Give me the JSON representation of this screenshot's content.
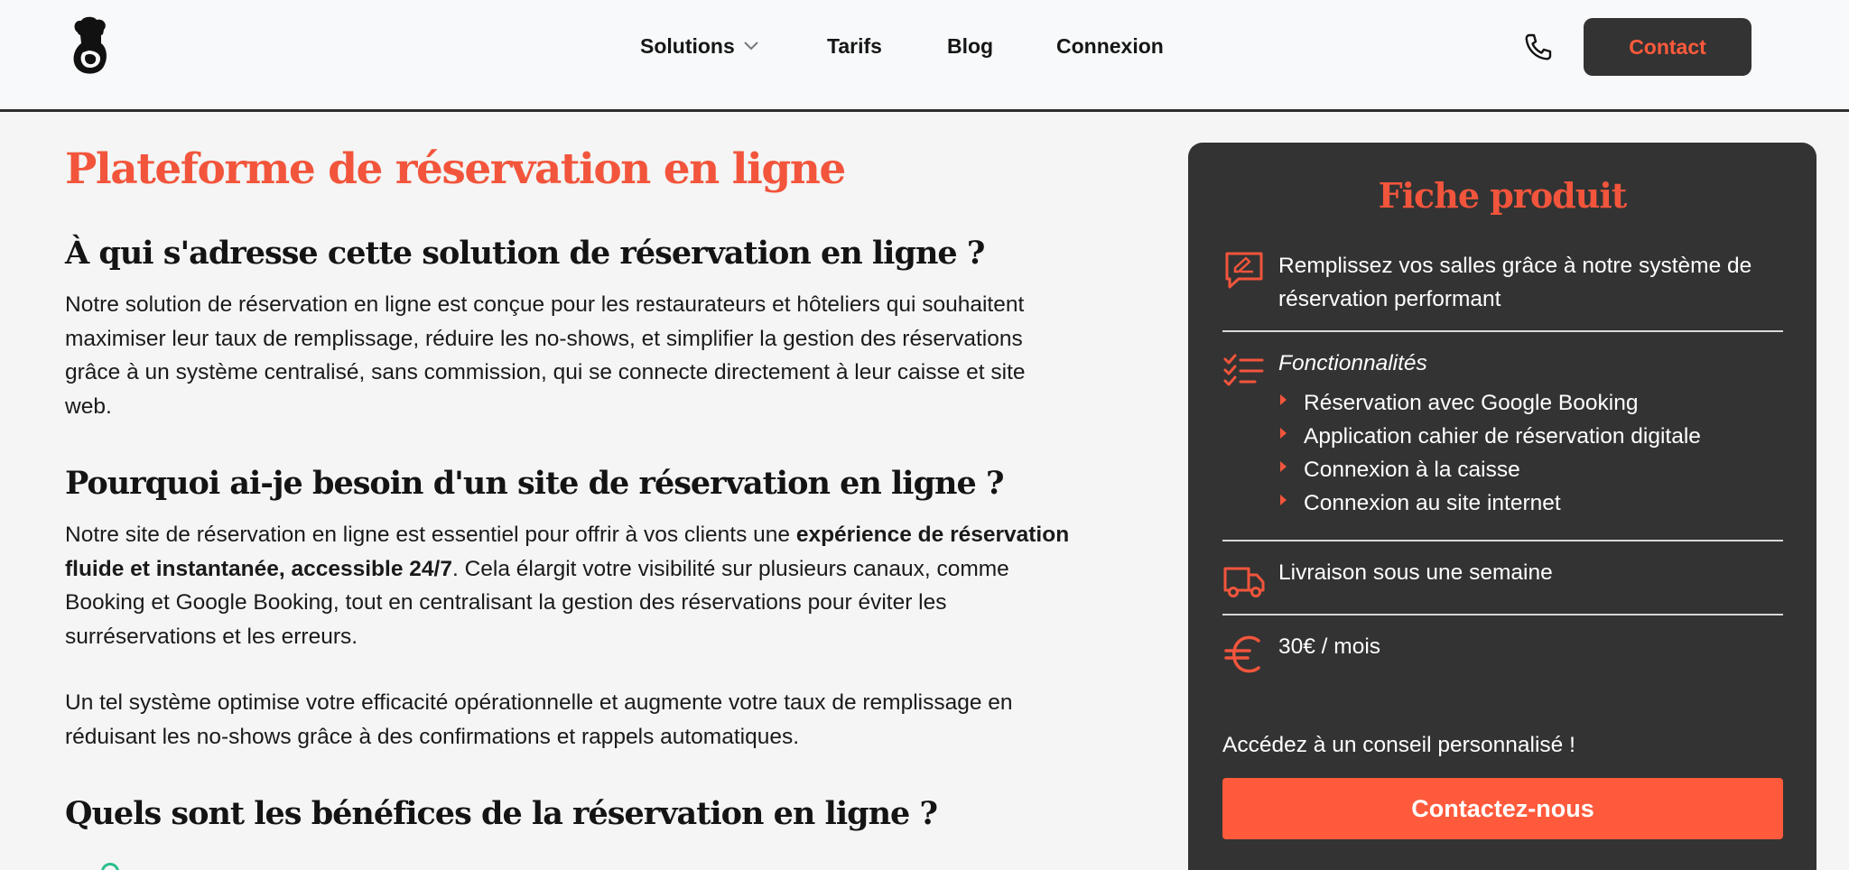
{
  "header": {
    "nav": {
      "solutions": "Solutions",
      "tarifs": "Tarifs",
      "blog": "Blog",
      "connexion": "Connexion"
    },
    "contact_label": "Contact"
  },
  "main": {
    "title": "Plateforme de réservation en ligne",
    "sections": [
      {
        "heading": "À qui s'adresse cette solution de réservation en ligne ?",
        "text": "Notre solution de réservation en ligne est conçue pour les restaurateurs et hôteliers qui souhaitent maximiser leur taux de remplissage, réduire les no-shows, et simplifier la gestion des réservations grâce à un système centralisé, sans commission, qui se connecte directement à leur caisse et site web."
      },
      {
        "heading": "Pourquoi ai-je besoin d'un site de réservation en ligne ?",
        "text_before": "Notre site de réservation en ligne est essentiel pour offrir à vos clients une ",
        "text_bold": "expérience de réservation fluide et instantanée, accessible 24/7",
        "text_after": ". Cela élargit votre visibilité sur plusieurs canaux, comme Booking et Google Booking, tout en centralisant la gestion des réservations pour éviter les surréservations et les erreurs.",
        "text2": "Un tel système optimise votre efficacité opérationnelle et augmente votre taux de remplissage en réduisant les no-shows grâce à des confirmations et rappels automatiques."
      },
      {
        "heading": "Quels sont les bénéfices de la réservation en ligne ?"
      }
    ]
  },
  "card": {
    "title": "Fiche produit",
    "intro": "Remplissez vos salles grâce à notre système de réservation performant",
    "features_title": "Fonctionnalités",
    "features": [
      "Réservation avec Google Booking",
      "Application cahier de réservation digitale",
      "Connexion à la caisse",
      "Connexion au site internet"
    ],
    "delivery": "Livraison sous une semaine",
    "price": "30€ / mois",
    "advice": "Accédez à un conseil personnalisé !",
    "cta": "Contactez-nous"
  },
  "colors": {
    "accent": "#f2553c",
    "button_orange": "#ff5a3c",
    "dark": "#333333"
  },
  "icons": [
    "chef-logo-icon",
    "chevron-down-icon",
    "phone-icon",
    "message-edit-icon",
    "checklist-icon",
    "truck-icon",
    "euro-icon",
    "triangle-bullet-icon"
  ]
}
